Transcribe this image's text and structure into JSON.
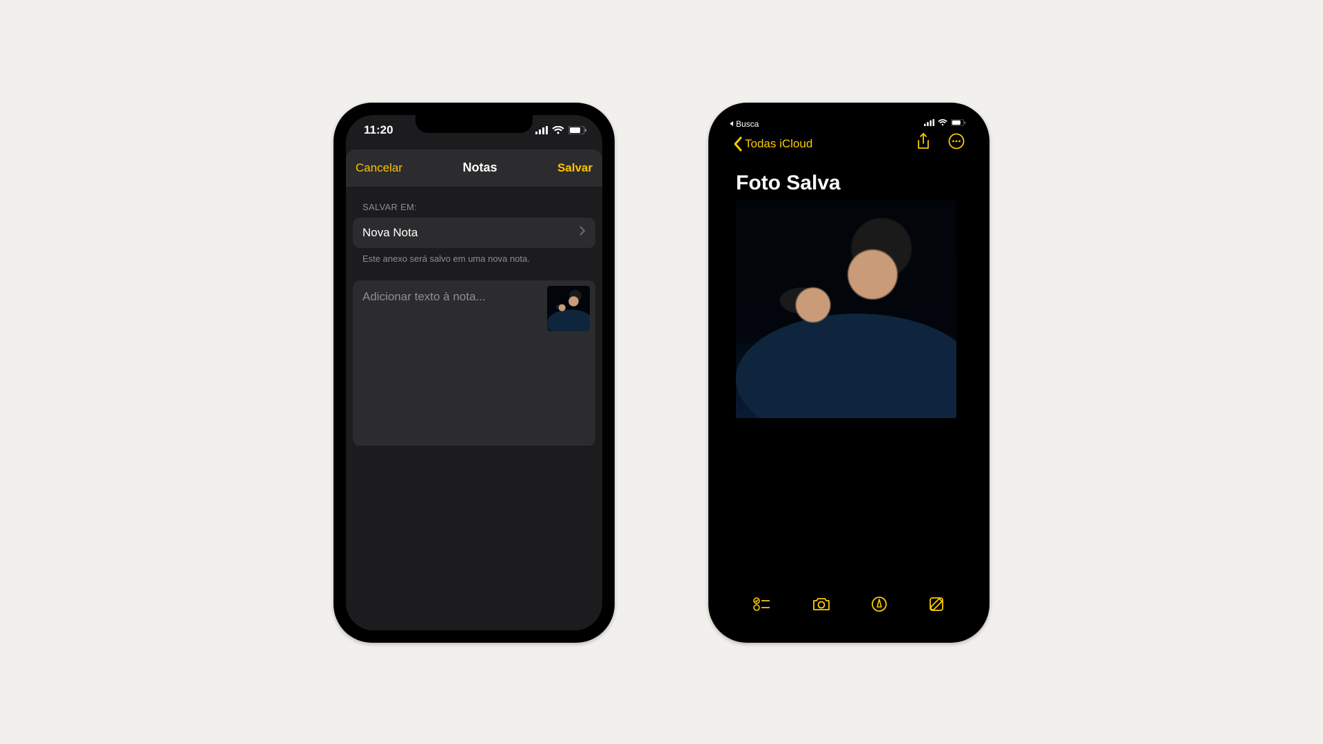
{
  "left": {
    "status_time": "11:20",
    "sheet": {
      "cancel": "Cancelar",
      "title": "Notas",
      "save": "Salvar",
      "section_label": "SALVAR EM:",
      "destination": "Nova Nota",
      "hint": "Este anexo será salvo em uma nova nota.",
      "placeholder": "Adicionar texto à nota..."
    }
  },
  "right": {
    "breadcrumb": "Busca",
    "back_label": "Todas iCloud",
    "note_title": "Foto Salva"
  }
}
